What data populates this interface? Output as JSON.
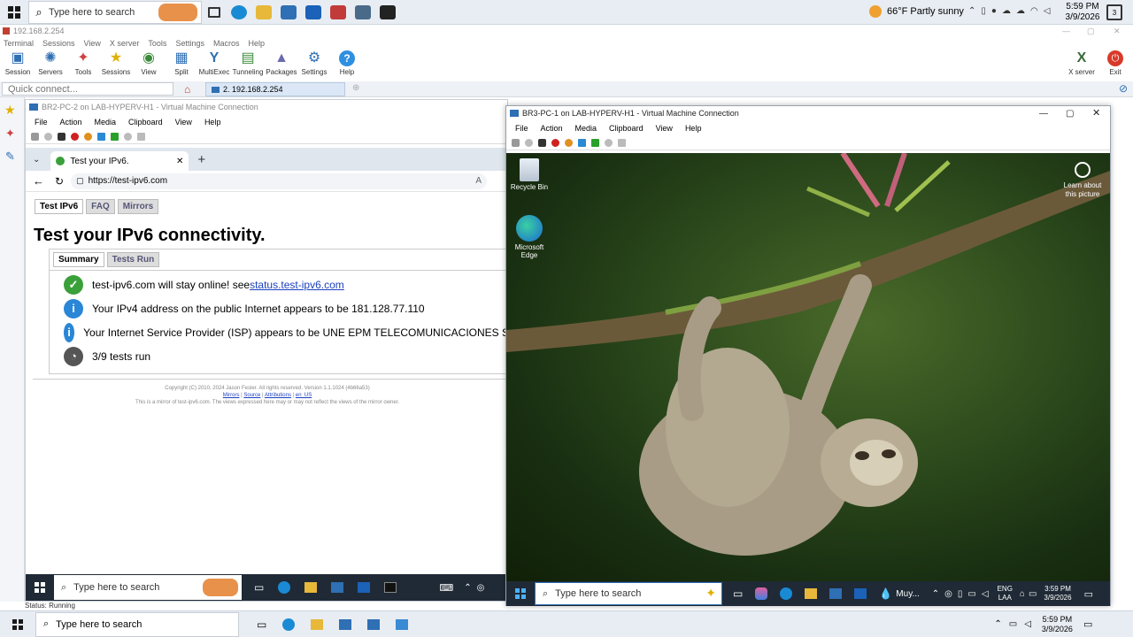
{
  "host_taskbar": {
    "search_placeholder": "Type here to search",
    "weather": "66°F  Partly sunny",
    "time": "5:59 PM",
    "date": "3/9/2026"
  },
  "moba": {
    "title": "192.168.2.254",
    "menu": [
      "Terminal",
      "Sessions",
      "View",
      "X server",
      "Tools",
      "Settings",
      "Macros",
      "Help"
    ],
    "toolbar": [
      {
        "label": "Session",
        "glyph": "▣",
        "color": "#2f6fb3"
      },
      {
        "label": "Servers",
        "glyph": "✺",
        "color": "#2f6fb3"
      },
      {
        "label": "Tools",
        "glyph": "✦",
        "color": "#d04040"
      },
      {
        "label": "Sessions",
        "glyph": "★",
        "color": "#e0b000"
      },
      {
        "label": "View",
        "glyph": "◉",
        "color": "#3a8a3a"
      },
      {
        "label": "Split",
        "glyph": "▦",
        "color": "#2f6fb3"
      },
      {
        "label": "MultiExec",
        "glyph": "Y",
        "color": "#2f6fb3"
      },
      {
        "label": "Tunneling",
        "glyph": "▤",
        "color": "#3a8a3a"
      },
      {
        "label": "Packages",
        "glyph": "▲",
        "color": "#6a6ab0"
      },
      {
        "label": "Settings",
        "glyph": "⚙",
        "color": "#2f6fb3"
      },
      {
        "label": "Help",
        "glyph": "?",
        "color": "#2f8fe0"
      }
    ],
    "xserver_label": "X server",
    "exit_label": "Exit",
    "quick_connect_placeholder": "Quick connect...",
    "session_tab": "2. 192.168.2.254",
    "status": "Status: Running"
  },
  "vm1": {
    "title": "BR2-PC-2 on LAB-HYPERV-H1 - Virtual Machine Connection",
    "menu": [
      "File",
      "Action",
      "Media",
      "Clipboard",
      "View",
      "Help"
    ],
    "browser_tab": "Test your IPv6.",
    "url": "https://test-ipv6.com",
    "page_tabs": [
      "Test IPv6",
      "FAQ",
      "Mirrors"
    ],
    "heading": "Test your IPv6 connectivity.",
    "sub_tabs": [
      "Summary",
      "Tests Run"
    ],
    "results": [
      {
        "text": "test-ipv6.com will stay online! see ",
        "link": "status.test-ipv6.com",
        "icon": "check-icon",
        "color": "#3aa03a"
      },
      {
        "text": "Your IPv4 address on the public Internet appears to be 181.128.77.110",
        "link": "",
        "icon": "info-icon",
        "color": "#2a86d6"
      },
      {
        "text": "Your Internet Service Provider (ISP) appears to be UNE EPM TELECOMUNICACIONES S",
        "link": "",
        "icon": "info-icon",
        "color": "#2a86d6"
      },
      {
        "text": "3/9 tests run",
        "link": "",
        "icon": "progress-icon",
        "color": "#555555"
      }
    ],
    "footer_line1": "Copyright (C) 2010, 2024 Jason Fesler. All rights reserved. Version 1.1.1024 (4b66a53)",
    "footer_links": [
      "Mirrors",
      "Source",
      "Attributions",
      "en_US"
    ],
    "footer_line3": "This is a mirror of test-ipv6.com. The views expressed here may or may not reflect the views of the mirror owner.",
    "taskbar_search": "Type here to search"
  },
  "vm2": {
    "title": "BR3-PC-1 on LAB-HYPERV-H1 - Virtual Machine Connection",
    "menu": [
      "File",
      "Action",
      "Media",
      "Clipboard",
      "View",
      "Help"
    ],
    "desktop_icons": [
      {
        "label": "Recycle Bin"
      },
      {
        "label": "Microsoft Edge"
      }
    ],
    "learn_about": "Learn about this picture",
    "taskbar_search": "Type here to search",
    "weather": "Muy...",
    "lang1": "ENG",
    "lang2": "LAA",
    "time": "3:59 PM",
    "date": "3/9/2026"
  },
  "host_bottom": {
    "search_placeholder": "Type here to search",
    "time": "5:59 PM",
    "date": "3/9/2026"
  }
}
